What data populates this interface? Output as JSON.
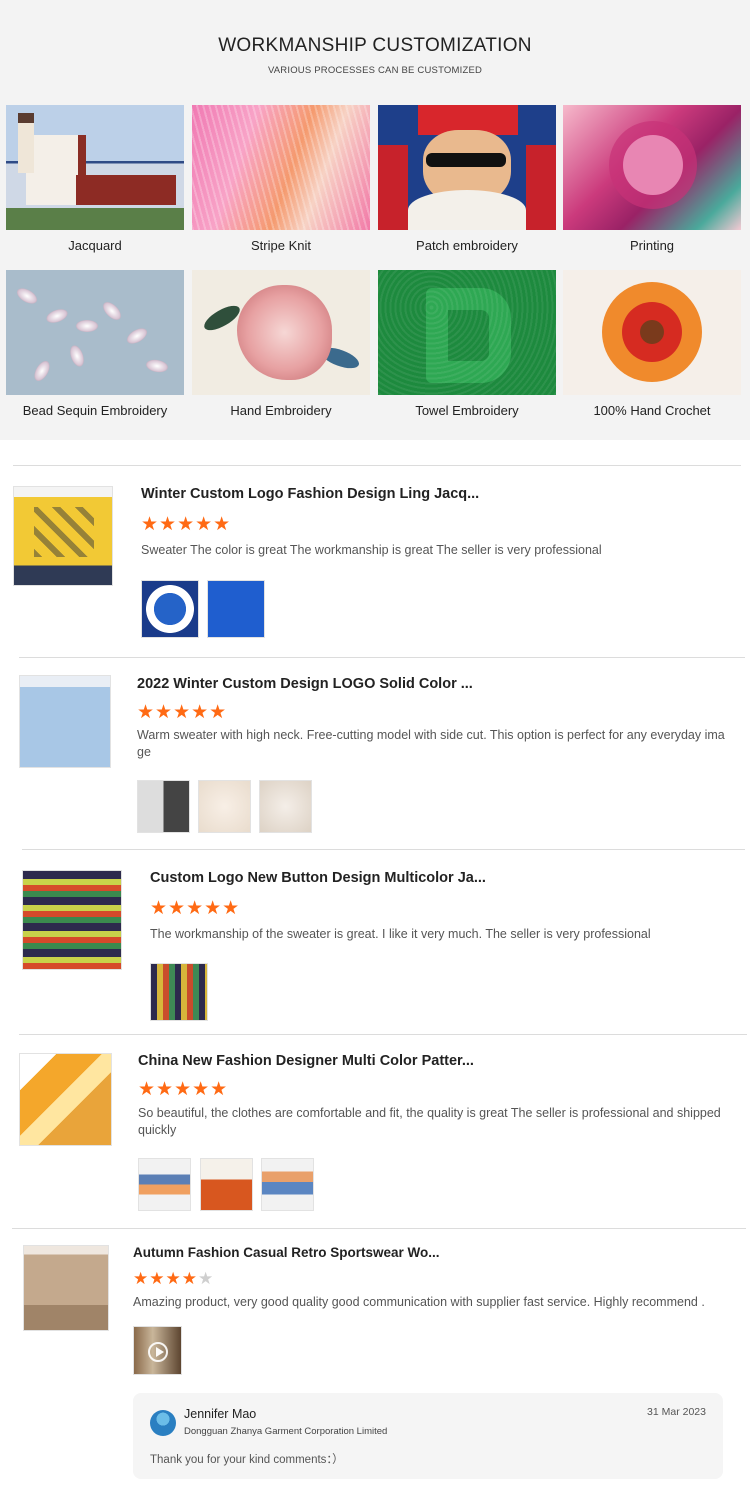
{
  "workmanship": {
    "title": "WORKMANSHIP CUSTOMIZATION",
    "subtitle": "VARIOUS PROCESSES CAN BE CUSTOMIZED",
    "items": [
      {
        "label": "Jacquard"
      },
      {
        "label": "Stripe Knit"
      },
      {
        "label": "Patch embroidery"
      },
      {
        "label": "Printing"
      },
      {
        "label": "Bead Sequin Embroidery"
      },
      {
        "label": "Hand Embroidery"
      },
      {
        "label": "Towel Embroidery"
      },
      {
        "label": "100% Hand Crochet"
      }
    ]
  },
  "reviews": [
    {
      "title": "Winter Custom Logo Fashion Design Ling Jacq...",
      "rating": 5,
      "stars": "★★★★★",
      "text": "Sweater The color is great The workmanship is great The seller is very professional"
    },
    {
      "title": "2022 Winter Custom Design LOGO Solid Color ...",
      "rating": 5,
      "stars": "★★★★★",
      "text": "Warm sweater with high neck. Free-cutting model with side cut. This option is perfect for any everyday ima ge"
    },
    {
      "title": "Custom Logo New Button Design Multicolor Ja...",
      "rating": 5,
      "stars": "★★★★★",
      "text": "The workmanship of the sweater is great. I like it very much. The seller is very professional"
    },
    {
      "title": "China New Fashion Designer Multi Color Patter...",
      "rating": 5,
      "stars": "★★★★★",
      "text": "So beautiful, the clothes are comfortable and fit, the quality is great The seller is professional and shipped quickly"
    },
    {
      "title": "Autumn Fashion Casual Retro Sportswear Wo...",
      "rating": 4,
      "stars_on": "★★★★",
      "stars_off": "★",
      "text": "Amazing product, very good quality good communication with supplier fast service. Highly recommend ."
    }
  ],
  "reply": {
    "name": "Jennifer Mao",
    "company": "Dongguan Zhanya Garment Corporation Limited",
    "date": "31 Mar 2023",
    "message": "Thank you for your kind comments：）"
  },
  "colors": {
    "star": "#ff6a14",
    "section_bg": "#f3f3f3",
    "reply_bg": "#f5f5f5"
  }
}
